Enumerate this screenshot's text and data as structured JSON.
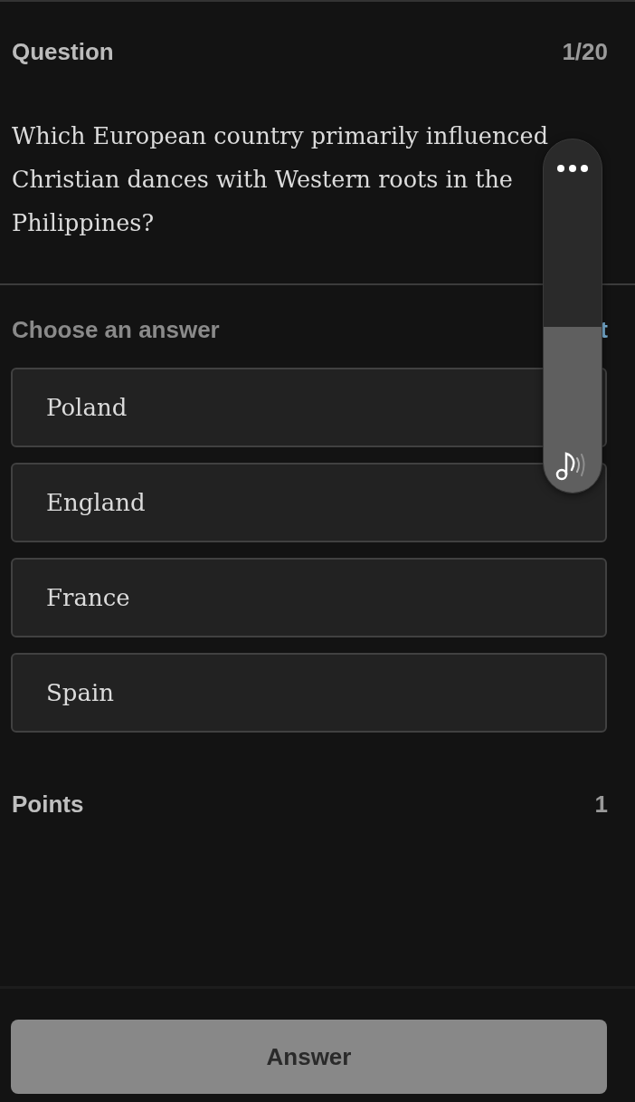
{
  "header": {
    "title": "Question",
    "counter": "1/20"
  },
  "question": {
    "text": "Which European country primarily influenced Christian dances with Western roots in the Philippines?"
  },
  "answers": {
    "label": "Choose an answer",
    "link": "t",
    "options": [
      {
        "label": "Poland",
        "selected": false
      },
      {
        "label": "England",
        "selected": false
      },
      {
        "label": "France",
        "selected": false
      },
      {
        "label": "Spain",
        "selected": false
      }
    ]
  },
  "points": {
    "label": "Points",
    "value": "1"
  },
  "answer_button": {
    "label": "Answer",
    "disabled": true
  },
  "volume_panel": {
    "level": 0.47
  }
}
